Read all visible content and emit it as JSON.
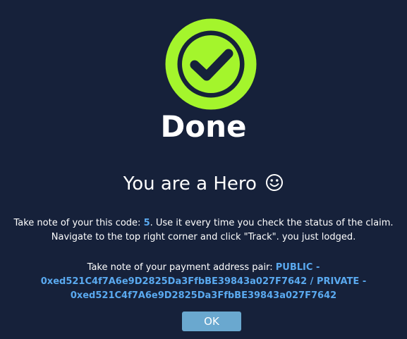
{
  "dialog": {
    "icon": "check-circle-icon",
    "icon_color": "#a4f52c",
    "background_color": "#16213a",
    "accent_color": "#5aa9ef",
    "button_color": "#6aa8cf",
    "title": "Done",
    "subtitle": "You are a Hero",
    "subtitle_icon": "smiley-face-icon",
    "message1": {
      "prefix": "Take note of your this code: ",
      "code": "5",
      "suffix": ". Use it every time you check the status of the claim.",
      "line2": "Navigate to the top right corner and click \"Track\". you just lodged."
    },
    "message2": {
      "prefix": "Take note of your payment address pair: ",
      "public_label": "PUBLIC -",
      "public_address": "0xed521C4f7A6e9D2825Da3FfbBE39843a027F7642",
      "separator": " / ",
      "private_label": "PRIVATE -",
      "private_address": "0xed521C4f7A6e9D2825Da3FfbBE39843a027F7642"
    },
    "ok_label": "OK"
  }
}
